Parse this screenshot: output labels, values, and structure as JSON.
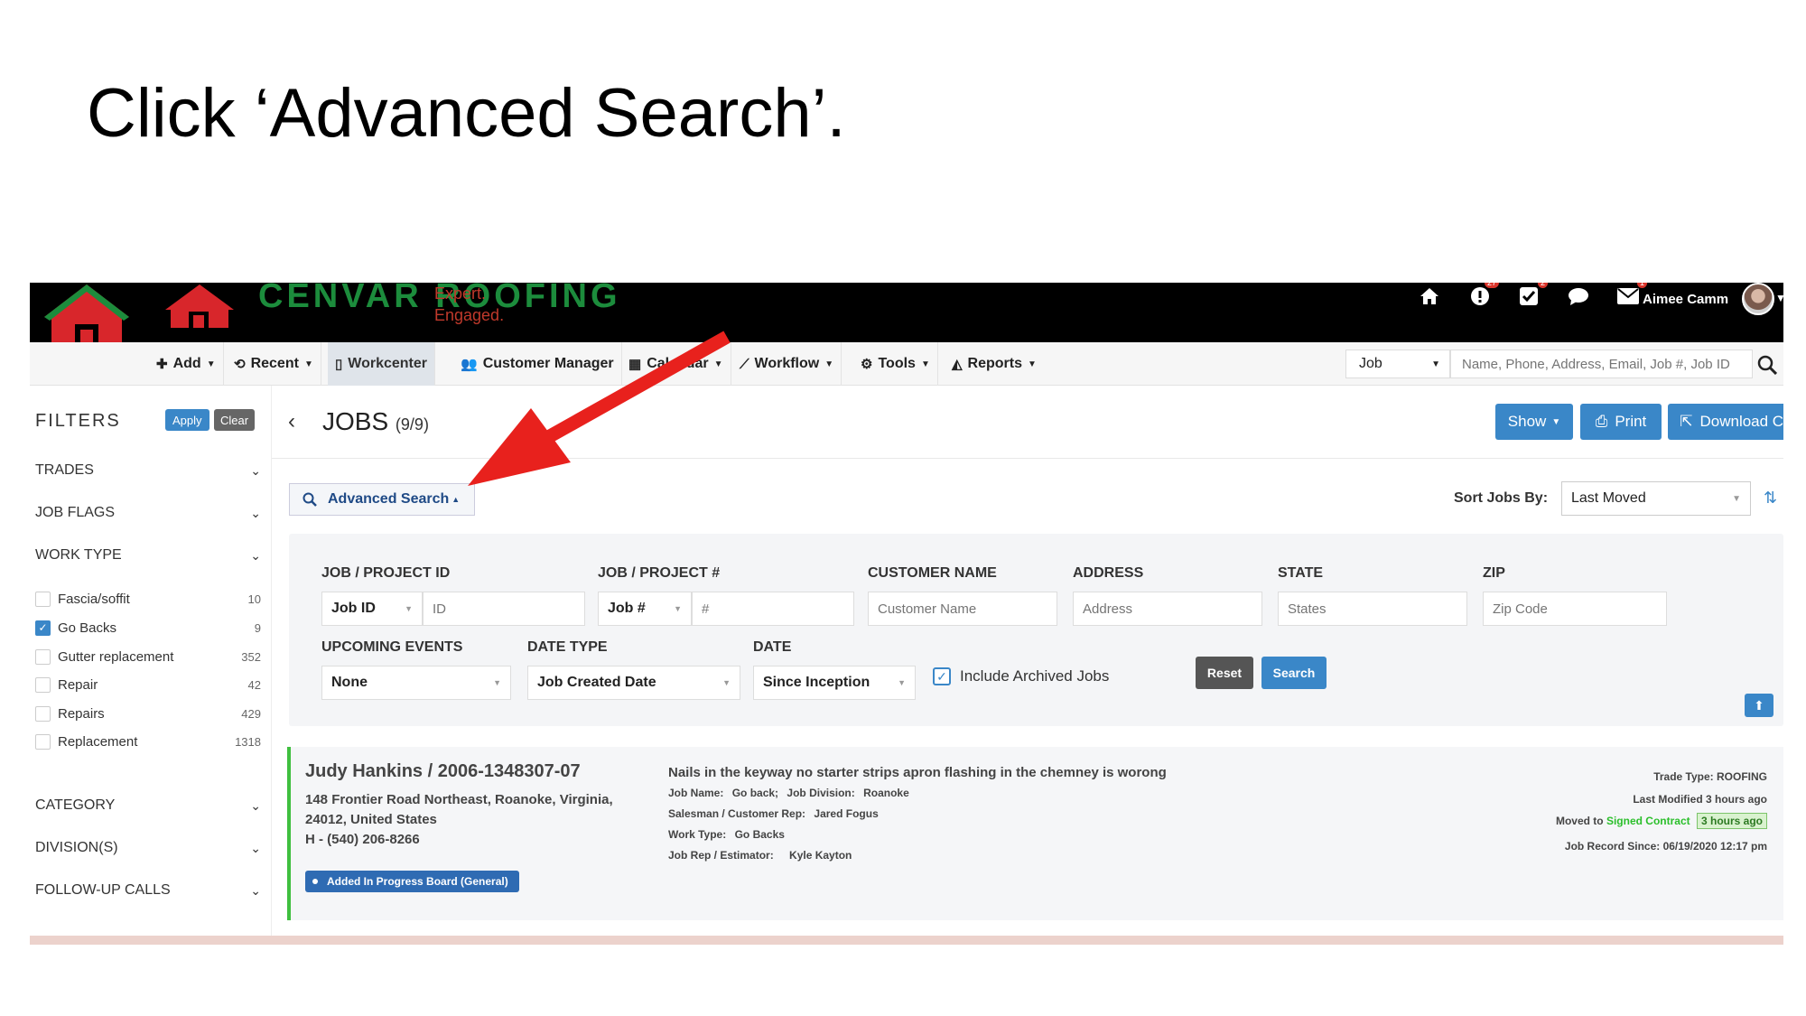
{
  "slide": {
    "title": "Click ‘Advanced Search’."
  },
  "brand": {
    "name": "CENVAR ROOFING",
    "tagline_1": "Expert.",
    "tagline_2": "Engaged."
  },
  "topbar": {
    "icons": [
      "home-icon",
      "alert-icon",
      "check-square-icon",
      "chat-icon",
      "mail-icon"
    ],
    "badges": {
      "alert": "27",
      "tasks": "2",
      "mail": "1"
    },
    "user_name": "Aimee Camm"
  },
  "nav": {
    "add": "Add",
    "recent": "Recent",
    "workcenter": "Workcenter",
    "customer_manager": "Customer Manager",
    "calendar": "Calendar",
    "workflow": "Workflow",
    "tools": "Tools",
    "reports": "Reports",
    "search_type": "Job",
    "search_placeholder": "Name, Phone, Address, Email, Job #, Job ID"
  },
  "sidebar": {
    "title": "FILTERS",
    "apply": "Apply",
    "clear": "Clear",
    "sections": [
      "TRADES",
      "JOB FLAGS",
      "WORK TYPE",
      "CATEGORY",
      "DIVISION(S)",
      "FOLLOW-UP CALLS"
    ],
    "work_types": [
      {
        "label": "Fascia/soffit",
        "count": "10",
        "checked": false
      },
      {
        "label": "Go Backs",
        "count": "9",
        "checked": true
      },
      {
        "label": "Gutter replacement",
        "count": "352",
        "checked": false
      },
      {
        "label": "Repair",
        "count": "42",
        "checked": false
      },
      {
        "label": "Repairs",
        "count": "429",
        "checked": false
      },
      {
        "label": "Replacement",
        "count": "1318",
        "checked": false
      }
    ]
  },
  "main": {
    "title": "JOBS",
    "count": "(9/9)",
    "show": "Show",
    "print": "Print",
    "download": "Download CSV",
    "advanced_search": "Advanced Search",
    "sort_label": "Sort Jobs By:",
    "sort_value": "Last Moved"
  },
  "advanced": {
    "job_project_id_label": "JOB / PROJECT ID",
    "job_project_num_label": "JOB / PROJECT #",
    "customer_name_label": "CUSTOMER NAME",
    "address_label": "ADDRESS",
    "state_label": "STATE",
    "zip_label": "ZIP",
    "job_id_select": "Job ID",
    "id_placeholder": "ID",
    "job_num_select": "Job #",
    "num_placeholder": "#",
    "customer_placeholder": "Customer Name",
    "address_placeholder": "Address",
    "states_placeholder": "States",
    "zip_placeholder": "Zip Code",
    "upcoming_label": "UPCOMING EVENTS",
    "date_type_label": "DATE TYPE",
    "date_label": "DATE",
    "upcoming_value": "None",
    "date_type_value": "Job Created Date",
    "date_value": "Since Inception",
    "include_archived": "Include Archived Jobs",
    "reset": "Reset",
    "search": "Search"
  },
  "job": {
    "title": "Judy Hankins / 2006-1348307-07",
    "address_1": "148 Frontier Road Northeast, Roanoke, Virginia,",
    "address_2": "24012, United States",
    "phone": "H - (540) 206-8266",
    "board_badge": "Added In Progress Board (General)",
    "note": "Nails in the keyway no starter strips apron flashing in the chemney is worong",
    "job_name_label": "Job Name:",
    "job_name": "Go back;",
    "division_label": "Job Division:",
    "division": "Roanoke",
    "salesman_label": "Salesman / Customer Rep:",
    "salesman": "Jared Fogus",
    "work_type_label": "Work Type:",
    "work_type": "Go Backs",
    "job_rep_label": "Job Rep / Estimator:",
    "job_rep": "Kyle Kayton",
    "trade_type": "Trade Type: ROOFING",
    "last_modified": "Last Modified 3 hours ago",
    "moved_to": "Moved to",
    "moved_status": "Signed Contract",
    "moved_ago": "3 hours ago",
    "record_since": "Job Record Since: 06/19/2020 12:17 pm"
  },
  "colors": {
    "accent": "#3a87c8",
    "arrow": "#e8211d",
    "brand_green": "#1c8c3c",
    "brand_red": "#c0392b"
  }
}
